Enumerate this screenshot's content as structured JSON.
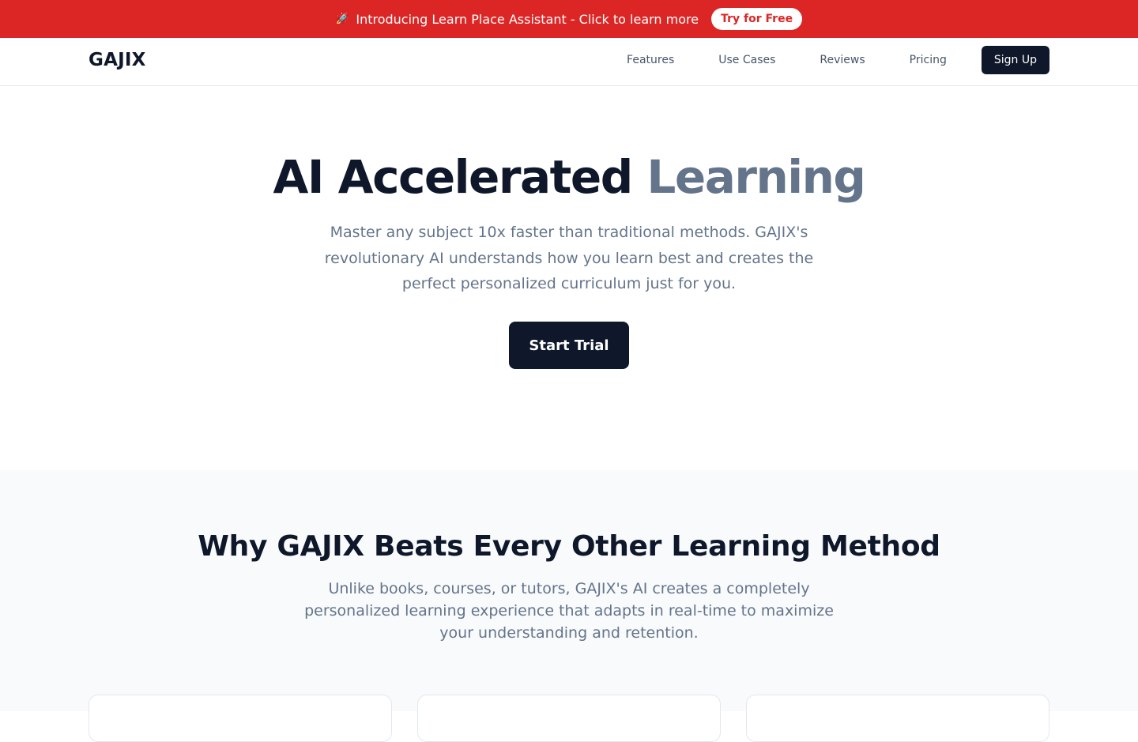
{
  "announcement": {
    "icon": "rocket-icon",
    "text": "Introducing Learn Place Assistant - Click to learn more",
    "cta_label": "Try for Free",
    "background": "#dc2626"
  },
  "header": {
    "logo": "GAJIX",
    "nav": [
      "Features",
      "Use Cases",
      "Reviews",
      "Pricing"
    ],
    "signup_label": "Sign Up"
  },
  "hero": {
    "title_main": "AI Accelerated",
    "title_accent": "Learning",
    "subtitle": "Master any subject 10x faster than traditional methods. GAJIX's revolutionary AI understands how you learn best and creates the perfect personalized curriculum just for you.",
    "cta_label": "Start Trial"
  },
  "features": {
    "title": "Why GAJIX Beats Every Other Learning Method",
    "subtitle": "Unlike books, courses, or tutors, GAJIX's AI creates a completely personalized learning experience that adapts in real-time to maximize your understanding and retention."
  },
  "colors": {
    "primary": "#0f172a",
    "muted": "#64748b",
    "section_bg": "#f8fafc"
  }
}
